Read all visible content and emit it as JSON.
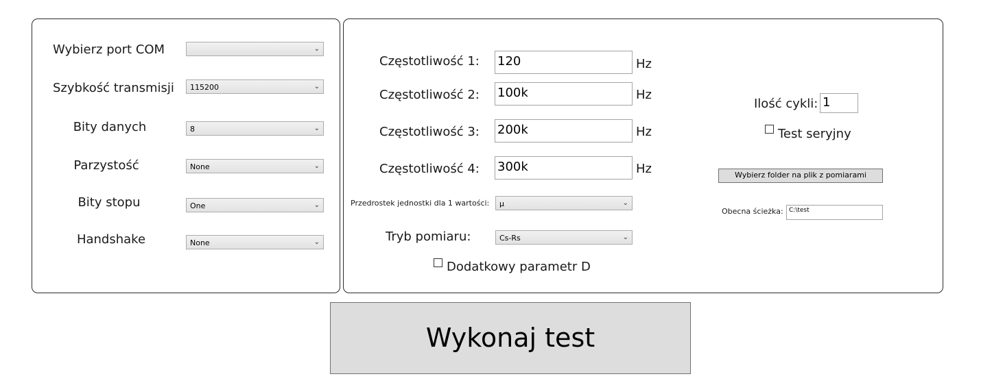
{
  "com": {
    "port_label": "Wybierz port COM",
    "port_value": "",
    "baud_label": "Szybkość transmisji",
    "baud_value": "115200",
    "databits_label": "Bity danych",
    "databits_value": "8",
    "parity_label": "Parzystość",
    "parity_value": "None",
    "stopbits_label": "Bity stopu",
    "stopbits_value": "One",
    "handshake_label": "Handshake",
    "handshake_value": "None"
  },
  "measure": {
    "freq1_label": "Częstotliwość 1:",
    "freq1_value": "120",
    "freq2_label": "Częstotliwość 2:",
    "freq2_value": "100k",
    "freq3_label": "Częstotliwość 3:",
    "freq3_value": "200k",
    "freq4_label": "Częstotliwość 4:",
    "freq4_value": "300k",
    "unit": "Hz",
    "prefix_label": "Przedrostek jednostki dla 1 wartości:",
    "prefix_value": "µ",
    "mode_label": "Tryb pomiaru:",
    "mode_value": "Cs-Rs",
    "extra_param_label": "Dodatkowy parametr D",
    "extra_param_checked": false
  },
  "test": {
    "cycles_label": "Ilość cykli:",
    "cycles_value": "1",
    "serial_label": "Test seryjny",
    "serial_checked": false,
    "folder_button": "Wybierz folder na plik z pomiarami",
    "path_label": "Obecna ścieżka:",
    "path_value": "C:\\test"
  },
  "run_button": "Wykonaj test",
  "icons": {
    "dropdown": "chevron-down-icon",
    "checkbox": "checkbox-icon"
  }
}
